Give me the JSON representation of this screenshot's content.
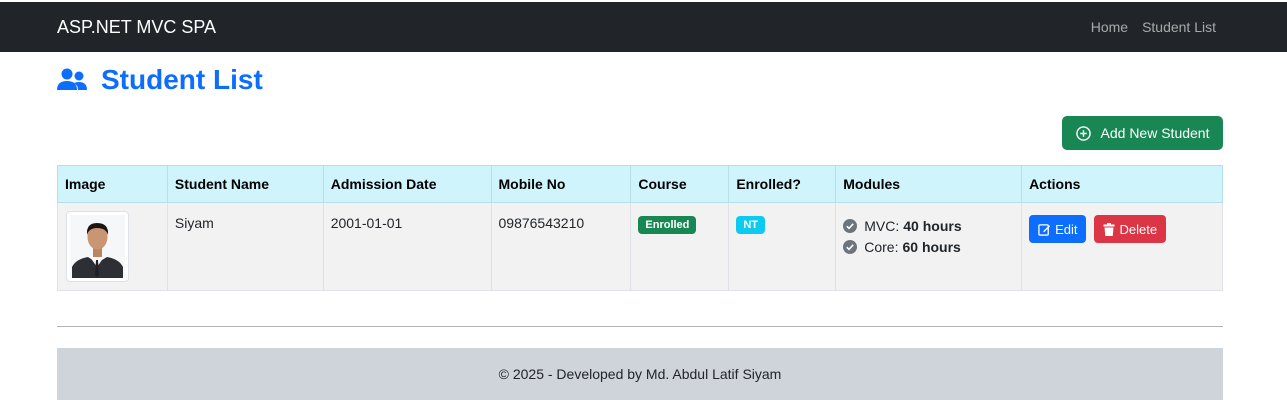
{
  "navbar": {
    "brand": "ASP.NET MVC SPA",
    "links": [
      "Home",
      "Student List"
    ],
    "background": "#212529"
  },
  "page": {
    "title": "Student List",
    "title_icon": "users-icon",
    "accent": "#0d6efd"
  },
  "toolbar": {
    "add_label": "Add New Student",
    "add_icon": "plus-circle-icon",
    "add_color": "#198754"
  },
  "table": {
    "headers": [
      "Image",
      "Student Name",
      "Admission Date",
      "Mobile No",
      "Course",
      "Enrolled?",
      "Modules",
      "Actions"
    ],
    "rows": [
      {
        "image": "student-photo",
        "name": "Siyam",
        "admission_date": "2001-01-01",
        "mobile": "09876543210",
        "course": "Enrolled",
        "enrolled": "NT",
        "modules": [
          {
            "label": "MVC:",
            "hours": "40 hours"
          },
          {
            "label": "Core:",
            "hours": "60 hours"
          }
        ],
        "edit_label": "Edit",
        "delete_label": "Delete"
      }
    ]
  },
  "footer": {
    "text": "© 2025 - Developed by Md. Abdul Latif Siyam"
  }
}
